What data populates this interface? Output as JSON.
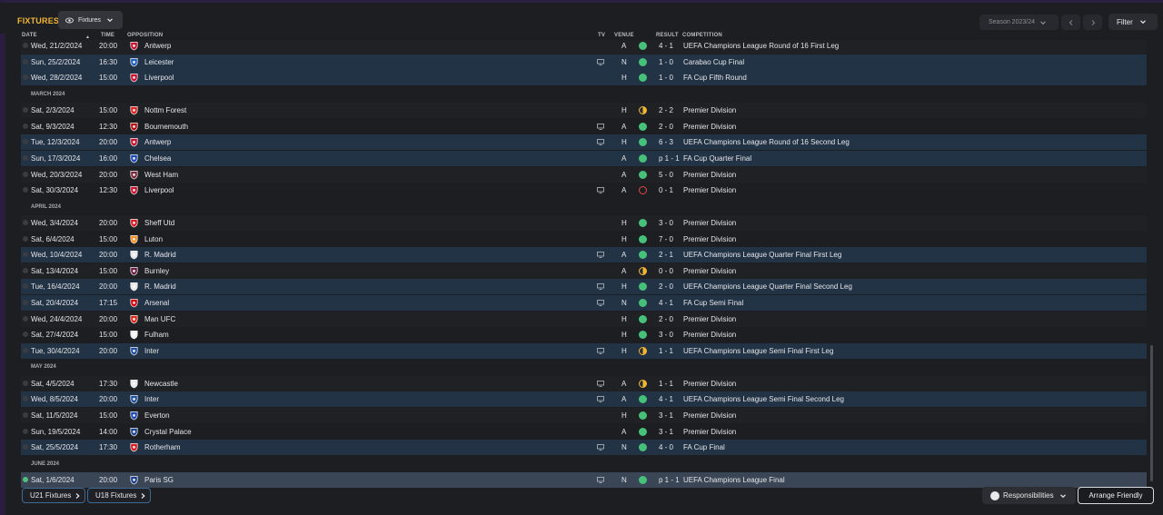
{
  "header": {
    "title": "FIXTURES",
    "view_selector": "Fixtures",
    "season": "Season 2023/24",
    "filter": "Filter"
  },
  "columns": {
    "date": "DATE",
    "time": "TIME",
    "opposition": "OPPOSITION",
    "tv": "TV",
    "venue": "VENUE",
    "result": "RESULT",
    "competition": "COMPETITION"
  },
  "colors": {
    "accent": "#f2b632",
    "win": "#47c07a",
    "draw": "#f2b632",
    "loss": "#e04848",
    "highlight_row": "#223346"
  },
  "rows": [
    {
      "kind": "fixture",
      "date": "Wed, 21/2/2024",
      "time": "20:00",
      "opp": "Antwerp",
      "badge": "#c8102e",
      "tv": false,
      "venue": "A",
      "outcome": "win",
      "result": "4 - 1",
      "comp": "UEFA Champions League Round of 16 First Leg",
      "style": "odd"
    },
    {
      "kind": "fixture",
      "date": "Sun, 25/2/2024",
      "time": "16:30",
      "opp": "Leicester",
      "badge": "#1d5fbf",
      "tv": true,
      "venue": "N",
      "outcome": "win",
      "result": "1 - 0",
      "comp": "Carabao Cup Final",
      "style": "hl"
    },
    {
      "kind": "fixture",
      "date": "Wed, 28/2/2024",
      "time": "15:00",
      "opp": "Liverpool",
      "badge": "#c8102e",
      "tv": false,
      "venue": "H",
      "outcome": "win",
      "result": "1 - 0",
      "comp": "FA Cup Fifth Round",
      "style": "hl"
    },
    {
      "kind": "month",
      "label": "MARCH 2024"
    },
    {
      "kind": "fixture",
      "date": "Sat, 2/3/2024",
      "time": "15:00",
      "opp": "Nottm Forest",
      "badge": "#dd2222",
      "tv": false,
      "venue": "H",
      "outcome": "draw",
      "result": "2 - 2",
      "comp": "Premier Division",
      "style": "odd"
    },
    {
      "kind": "fixture",
      "date": "Sat, 9/3/2024",
      "time": "12:30",
      "opp": "Bournemouth",
      "badge": "#b50e12",
      "tv": true,
      "venue": "A",
      "outcome": "win",
      "result": "2 - 0",
      "comp": "Premier Division",
      "style": "even"
    },
    {
      "kind": "fixture",
      "date": "Tue, 12/3/2024",
      "time": "20:00",
      "opp": "Antwerp",
      "badge": "#c8102e",
      "tv": true,
      "venue": "H",
      "outcome": "win",
      "result": "6 - 3",
      "comp": "UEFA Champions League Round of 16 Second Leg",
      "style": "hl"
    },
    {
      "kind": "fixture",
      "date": "Sun, 17/3/2024",
      "time": "16:00",
      "opp": "Chelsea",
      "badge": "#1d49b5",
      "tv": false,
      "venue": "A",
      "outcome": "win",
      "result": "p 1 - 1",
      "comp": "FA Cup Quarter Final",
      "style": "hl"
    },
    {
      "kind": "fixture",
      "date": "Wed, 20/3/2024",
      "time": "20:00",
      "opp": "West Ham",
      "badge": "#7a263a",
      "tv": false,
      "venue": "A",
      "outcome": "win",
      "result": "5 - 0",
      "comp": "Premier Division",
      "style": "odd"
    },
    {
      "kind": "fixture",
      "date": "Sat, 30/3/2024",
      "time": "12:30",
      "opp": "Liverpool",
      "badge": "#c8102e",
      "tv": true,
      "venue": "A",
      "outcome": "loss",
      "result": "0 - 1",
      "comp": "Premier Division",
      "style": "even"
    },
    {
      "kind": "month",
      "label": "APRIL 2024"
    },
    {
      "kind": "fixture",
      "date": "Wed, 3/4/2024",
      "time": "20:00",
      "opp": "Sheff Utd",
      "badge": "#d71920",
      "tv": false,
      "venue": "H",
      "outcome": "win",
      "result": "3 - 0",
      "comp": "Premier Division",
      "style": "odd"
    },
    {
      "kind": "fixture",
      "date": "Sat, 6/4/2024",
      "time": "15:00",
      "opp": "Luton",
      "badge": "#f78f1e",
      "tv": false,
      "venue": "H",
      "outcome": "win",
      "result": "7 - 0",
      "comp": "Premier Division",
      "style": "even"
    },
    {
      "kind": "fixture",
      "date": "Wed, 10/4/2024",
      "time": "20:00",
      "opp": "R. Madrid",
      "badge": "#e8e8ea",
      "tv": true,
      "venue": "A",
      "outcome": "win",
      "result": "2 - 1",
      "comp": "UEFA Champions League Quarter Final First Leg",
      "style": "hl"
    },
    {
      "kind": "fixture",
      "date": "Sat, 13/4/2024",
      "time": "15:00",
      "opp": "Burnley",
      "badge": "#6c1d45",
      "tv": false,
      "venue": "A",
      "outcome": "draw",
      "result": "0 - 0",
      "comp": "Premier Division",
      "style": "odd"
    },
    {
      "kind": "fixture",
      "date": "Tue, 16/4/2024",
      "time": "20:00",
      "opp": "R. Madrid",
      "badge": "#e8e8ea",
      "tv": true,
      "venue": "H",
      "outcome": "win",
      "result": "2 - 0",
      "comp": "UEFA Champions League Quarter Final Second Leg",
      "style": "hl"
    },
    {
      "kind": "fixture",
      "date": "Sat, 20/4/2024",
      "time": "17:15",
      "opp": "Arsenal",
      "badge": "#db0007",
      "tv": true,
      "venue": "N",
      "outcome": "win",
      "result": "4 - 1",
      "comp": "FA Cup Semi Final",
      "style": "hl"
    },
    {
      "kind": "fixture",
      "date": "Wed, 24/4/2024",
      "time": "20:00",
      "opp": "Man UFC",
      "badge": "#da291c",
      "tv": false,
      "venue": "H",
      "outcome": "win",
      "result": "2 - 0",
      "comp": "Premier Division",
      "style": "odd"
    },
    {
      "kind": "fixture",
      "date": "Sat, 27/4/2024",
      "time": "15:00",
      "opp": "Fulham",
      "badge": "#f2f2f2",
      "tv": false,
      "venue": "H",
      "outcome": "win",
      "result": "3 - 0",
      "comp": "Premier Division",
      "style": "even"
    },
    {
      "kind": "fixture",
      "date": "Tue, 30/4/2024",
      "time": "20:00",
      "opp": "Inter",
      "badge": "#1e4fa0",
      "tv": true,
      "venue": "H",
      "outcome": "draw",
      "result": "1 - 1",
      "comp": "UEFA Champions League Semi Final First Leg",
      "style": "hl"
    },
    {
      "kind": "month",
      "label": "MAY 2024"
    },
    {
      "kind": "fixture",
      "date": "Sat, 4/5/2024",
      "time": "17:30",
      "opp": "Newcastle",
      "badge": "#e8e8ea",
      "tv": true,
      "venue": "A",
      "outcome": "draw",
      "result": "1 - 1",
      "comp": "Premier Division",
      "style": "odd"
    },
    {
      "kind": "fixture",
      "date": "Wed, 8/5/2024",
      "time": "20:00",
      "opp": "Inter",
      "badge": "#1e4fa0",
      "tv": true,
      "venue": "A",
      "outcome": "win",
      "result": "4 - 1",
      "comp": "UEFA Champions League Semi Final Second Leg",
      "style": "hl"
    },
    {
      "kind": "fixture",
      "date": "Sat, 11/5/2024",
      "time": "15:00",
      "opp": "Everton",
      "badge": "#1d49b5",
      "tv": false,
      "venue": "H",
      "outcome": "win",
      "result": "3 - 1",
      "comp": "Premier Division",
      "style": "odd"
    },
    {
      "kind": "fixture",
      "date": "Sun, 19/5/2024",
      "time": "14:00",
      "opp": "Crystal Palace",
      "badge": "#1b458f",
      "tv": false,
      "venue": "A",
      "outcome": "win",
      "result": "3 - 1",
      "comp": "Premier Division",
      "style": "even"
    },
    {
      "kind": "fixture",
      "date": "Sat, 25/5/2024",
      "time": "17:30",
      "opp": "Rotherham",
      "badge": "#d71920",
      "tv": true,
      "venue": "N",
      "outcome": "win",
      "result": "4 - 0",
      "comp": "FA Cup Final",
      "style": "hl"
    },
    {
      "kind": "month",
      "label": "JUNE 2024"
    },
    {
      "kind": "fixture",
      "date": "Sat, 1/6/2024",
      "time": "20:00",
      "opp": "Paris SG",
      "badge": "#1d3f8a",
      "tv": true,
      "venue": "N",
      "outcome": "win",
      "result": "p 1 - 1",
      "comp": "UEFA Champions League Final",
      "style": "sel"
    }
  ],
  "footer": {
    "u21": "U21 Fixtures",
    "u18": "U18 Fixtures",
    "responsibilities": "Responsibilities",
    "arrange_friendly": "Arrange Friendly"
  }
}
